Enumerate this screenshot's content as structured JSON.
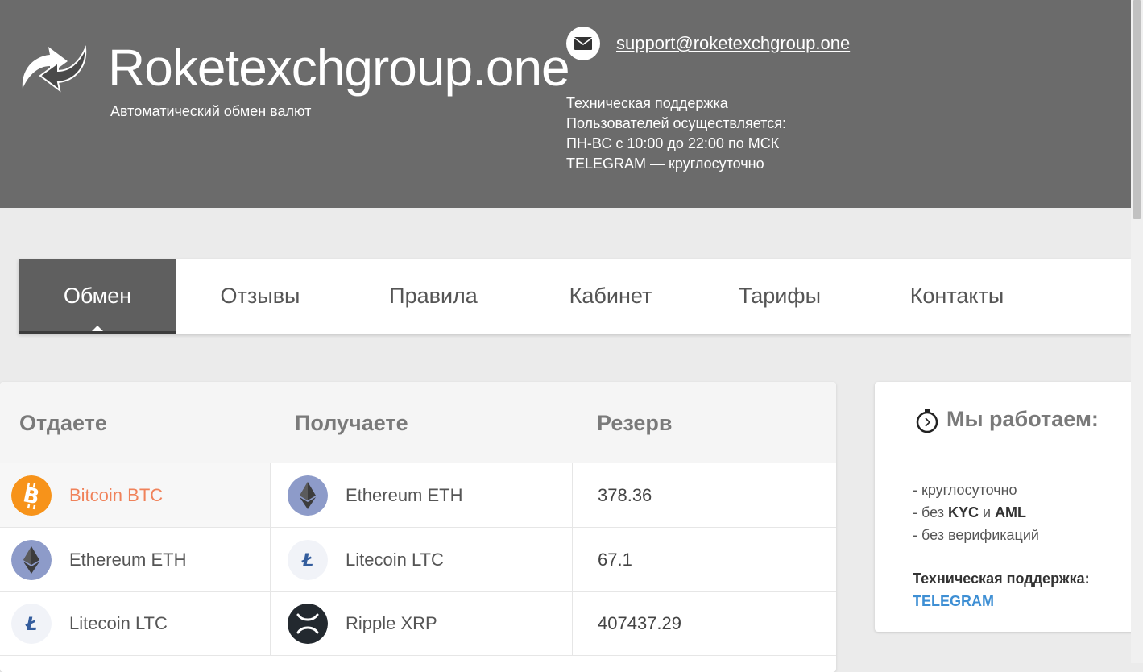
{
  "header": {
    "site_name": "Roketexchgroup.one",
    "tagline": "Автоматический обмен валют",
    "support_email": "support@roketexchgroup.one",
    "support_lines": [
      "Техническая поддержка",
      "Пользователей осуществляется:",
      "ПН-ВС с 10:00 до 22:00 по МСК",
      "TELEGRAM — круглосуточно"
    ]
  },
  "nav": {
    "items": [
      "Обмен",
      "Отзывы",
      "Правила",
      "Кабинет",
      "Тарифы",
      "Контакты"
    ],
    "active": "Обмен"
  },
  "exchange": {
    "columns": [
      "Отдаете",
      "Получаете",
      "Резерв"
    ],
    "rows": [
      {
        "from": "Bitcoin BTC",
        "from_icon": "bitcoin-icon",
        "to": "Ethereum ETH",
        "to_icon": "ethereum-icon",
        "reserve": "378.36"
      },
      {
        "from": "Ethereum ETH",
        "from_icon": "ethereum-icon",
        "to": "Litecoin LTC",
        "to_icon": "litecoin-icon",
        "reserve": "67.1"
      },
      {
        "from": "Litecoin LTC",
        "from_icon": "litecoin-icon",
        "to": "Ripple XRP",
        "to_icon": "ripple-icon",
        "reserve": "407437.29"
      }
    ]
  },
  "side": {
    "title": "Мы работаем:",
    "line1": "- круглосуточно",
    "line2_prefix": "- без ",
    "line2_kyc": "KYC",
    "line2_and": " и ",
    "line2_aml": "AML",
    "line3": "- без верификаций",
    "support_label": "Техническая поддержка:",
    "support_link": "TELEGRAM"
  },
  "colors": {
    "header_bg": "#6b6b6b",
    "nav_active_bg": "#5f5f5f",
    "highlight_text": "#f0825a",
    "link_blue": "#3e8fd4",
    "bitcoin_orange": "#f7931a"
  }
}
